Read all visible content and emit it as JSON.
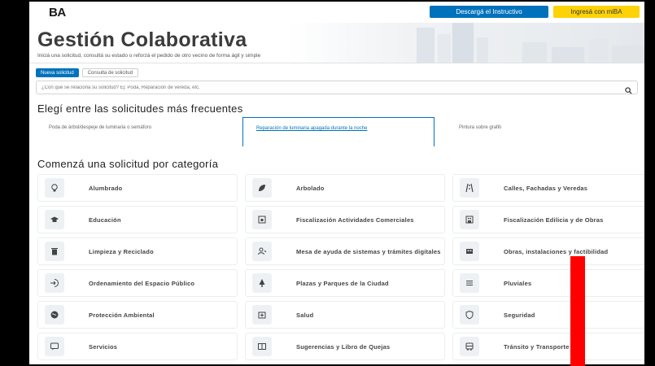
{
  "header": {
    "logo": "BA",
    "download_label": "Descargá el Instructivo",
    "login_label": "Ingresá con miBA"
  },
  "hero": {
    "title": "Gestión Colaborativa",
    "subtitle": "Iniciá una solicitud, consultá su estado o reforzá el pedido de otro vecino de forma ágil y simple"
  },
  "tabs": [
    {
      "label": "Nueva solicitud",
      "active": true
    },
    {
      "label": "Consulta de solicitud",
      "active": false
    }
  ],
  "search": {
    "placeholder": "¿Con qué se relaciona su solicitud? Ej: Poda, Reparación de vereda, etc."
  },
  "frequent": {
    "title": "Elegí entre las solicitudes más frecuentes",
    "items": [
      "Poda de árbol/despeje de luminaria o semáforo",
      "Reparación de luminaria apagada durante la noche",
      "Pintura sobre grafiti"
    ]
  },
  "categories": {
    "title": "Comenzá una solicitud por categoría",
    "items": [
      {
        "label": "Alumbrado",
        "icon": "lightbulb-icon"
      },
      {
        "label": "Arbolado",
        "icon": "leaf-icon"
      },
      {
        "label": "Calles, Fachadas y Veredas",
        "icon": "road-icon"
      },
      {
        "label": "Educación",
        "icon": "graduation-cap-icon"
      },
      {
        "label": "Fiscalización Actividades Comerciales",
        "icon": "store-icon"
      },
      {
        "label": "Fiscalización Edilicia y de Obras",
        "icon": "building-icon"
      },
      {
        "label": "Limpieza y Reciclado",
        "icon": "trash-icon"
      },
      {
        "label": "Mesa de ayuda de sistemas y trámites digitales",
        "icon": "support-icon"
      },
      {
        "label": "Obras, instalaciones y factibilidad",
        "icon": "construction-icon"
      },
      {
        "label": "Ordenamiento del Espacio Público",
        "icon": "sign-in-icon"
      },
      {
        "label": "Plazas y Parques de la Ciudad",
        "icon": "tree-icon"
      },
      {
        "label": "Pluviales",
        "icon": "drain-icon"
      },
      {
        "label": "Protección Ambiental",
        "icon": "globe-icon"
      },
      {
        "label": "Salud",
        "icon": "medical-icon"
      },
      {
        "label": "Seguridad",
        "icon": "shield-icon"
      },
      {
        "label": "Servicios",
        "icon": "chat-icon"
      },
      {
        "label": "Sugerencias y Libro de Quejas",
        "icon": "book-icon"
      },
      {
        "label": "Tránsito y Transporte",
        "icon": "bus-icon"
      }
    ]
  },
  "colors": {
    "primary": "#0072bb",
    "accent_yellow": "#fdd306",
    "overlay_red": "#ff0000"
  }
}
